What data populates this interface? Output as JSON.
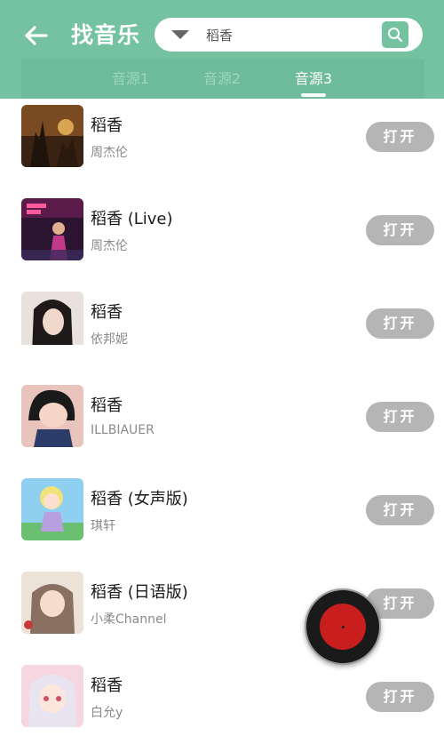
{
  "header": {
    "title": "找音乐",
    "search": {
      "value": "稻香",
      "placeholder": ""
    }
  },
  "tabs": [
    {
      "label": "音源1",
      "active": false
    },
    {
      "label": "音源2",
      "active": false
    },
    {
      "label": "音源3",
      "active": true
    }
  ],
  "songs": [
    {
      "title": "稻香",
      "artist": "周杰伦",
      "button": "打开",
      "cover_colors": [
        "#6b3a1f",
        "#c28a3a"
      ]
    },
    {
      "title": "稻香 (Live)",
      "artist": "周杰伦",
      "button": "打开",
      "cover_colors": [
        "#3a1f3a",
        "#c0398a"
      ]
    },
    {
      "title": "稻香",
      "artist": "依邦妮",
      "button": "打开",
      "cover_colors": [
        "#2a2a2a",
        "#d8cfc8"
      ]
    },
    {
      "title": "稻香",
      "artist": "ILLBIAUER",
      "button": "打开",
      "cover_colors": [
        "#e8b8b0",
        "#2b3b6a"
      ]
    },
    {
      "title": "稻香 (女声版)",
      "artist": "琪轩",
      "button": "打开",
      "cover_colors": [
        "#8fd0f0",
        "#f2e27a"
      ]
    },
    {
      "title": "稻香 (日语版)",
      "artist": "小柔Channel",
      "button": "打开",
      "cover_colors": [
        "#e8dcd2",
        "#8a6a5a"
      ]
    },
    {
      "title": "稻香",
      "artist": "白允y",
      "button": "打开",
      "cover_colors": [
        "#f6d6e0",
        "#c8b8d8"
      ]
    }
  ],
  "player": {
    "icon": "vinyl-record-icon",
    "accent": "#c81e1e"
  },
  "colors": {
    "brand": "#74c29f",
    "button_gray": "#b5b5b5"
  }
}
